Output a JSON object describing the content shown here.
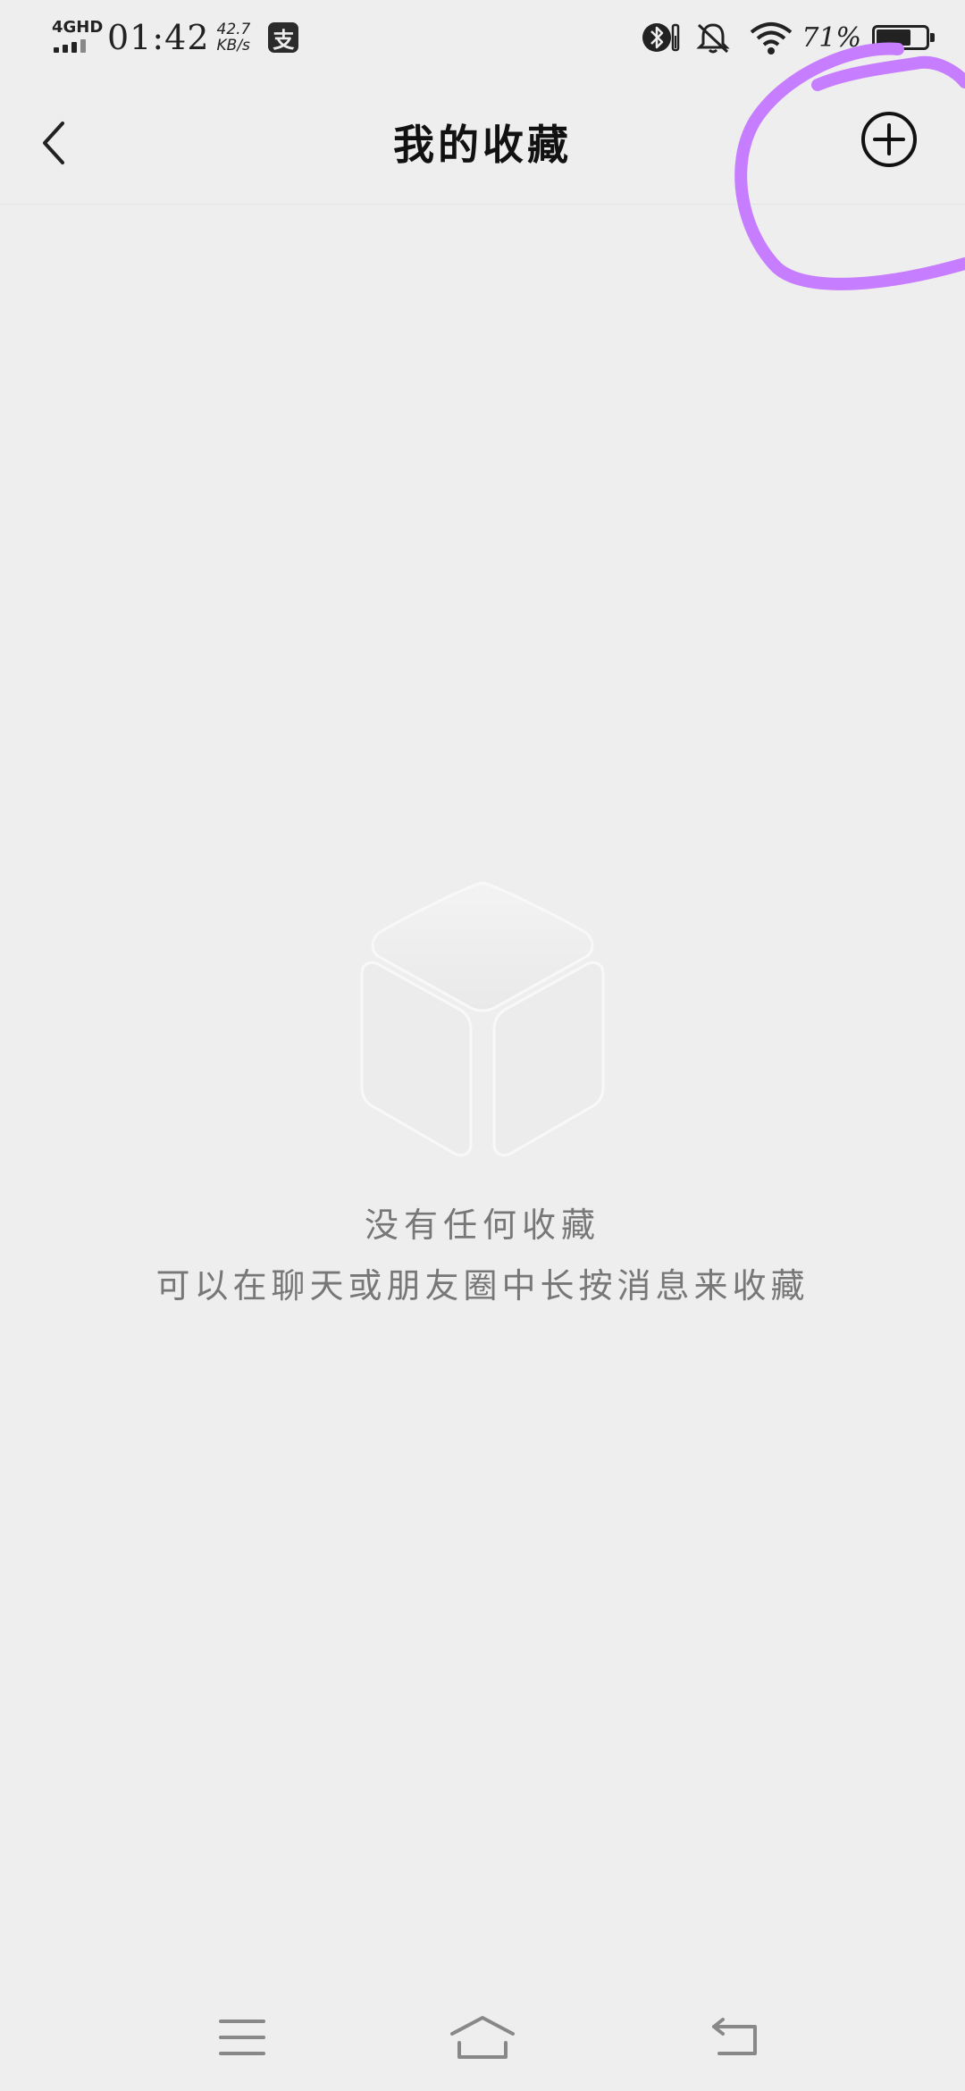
{
  "status_bar": {
    "network": "4GHD",
    "time": "01:42",
    "speed_value": "42.7",
    "speed_unit": "KB/s",
    "app_badge": "支",
    "battery_percent": "71%",
    "battery_level": 0.71,
    "icons": [
      "bluetooth-icon",
      "silent-bell-icon",
      "wifi-icon",
      "battery-icon"
    ]
  },
  "header": {
    "title": "我的收藏",
    "back_icon": "chevron-left-icon",
    "add_icon": "plus-circle-icon"
  },
  "annotation": {
    "color": "#c77dff"
  },
  "empty_state": {
    "icon": "box-icon",
    "title": "没有任何收藏",
    "hint": "可以在聊天或朋友圈中长按消息来收藏"
  },
  "nav_bar": {
    "icons": [
      "menu-icon",
      "home-icon",
      "back-icon"
    ]
  }
}
